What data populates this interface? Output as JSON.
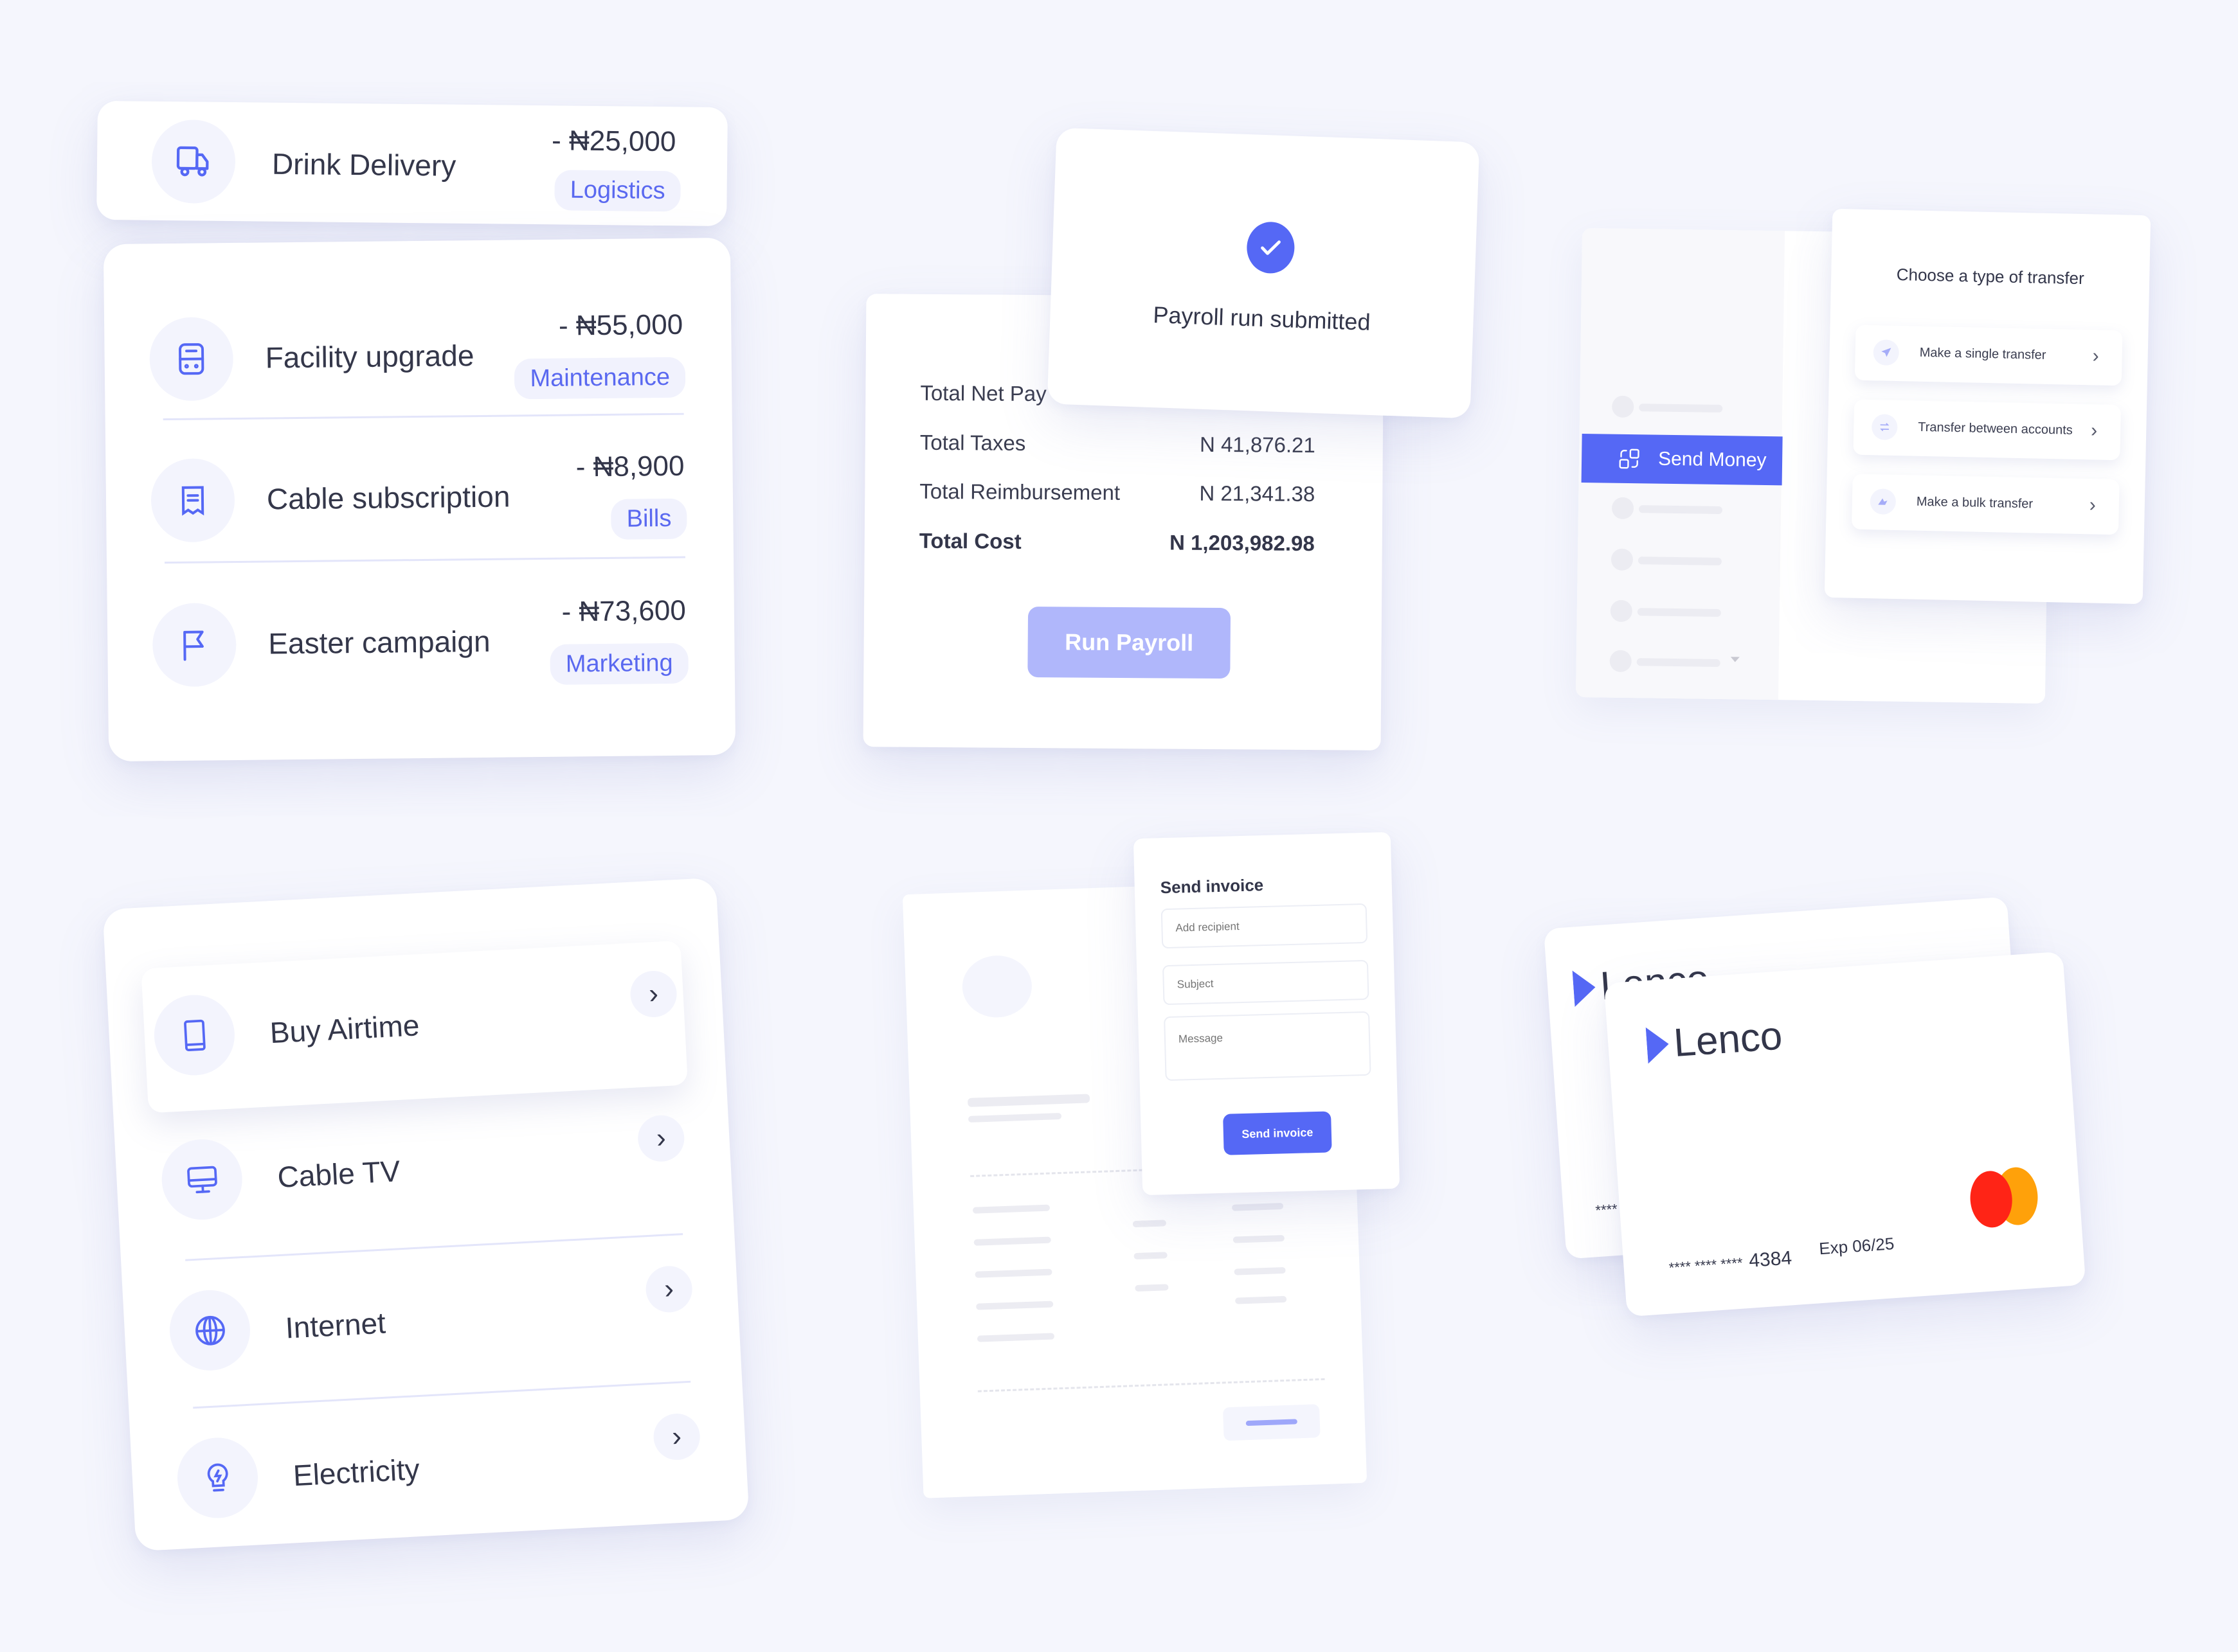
{
  "colors": {
    "accent": "#5568f5",
    "accent_light": "#b0b7fb",
    "background": "#f5f6fd",
    "mastercard_red": "#ff2416",
    "mastercard_orange": "#ffa10a"
  },
  "expenses": {
    "featured": {
      "icon": "truck-icon",
      "title": "Drink Delivery",
      "amount": "- ₦25,000",
      "category": "Logistics"
    },
    "items": [
      {
        "icon": "server-icon",
        "title": "Facility upgrade",
        "amount": "- ₦55,000",
        "category": "Maintenance"
      },
      {
        "icon": "receipt-icon",
        "title": "Cable subscription",
        "amount": "- ₦8,900",
        "category": "Bills"
      },
      {
        "icon": "flag-icon",
        "title": "Easter campaign",
        "amount": "- ₦73,600",
        "category": "Marketing"
      }
    ]
  },
  "payroll": {
    "confirmation": {
      "icon": "check-circle-icon",
      "message": "Payroll run submitted"
    },
    "rows": [
      {
        "label": "Total Net Pay",
        "value": ""
      },
      {
        "label": "Total  Taxes",
        "value": "N 41,876.21"
      },
      {
        "label": "Total  Reimbursement",
        "value": "N 21,341.38"
      },
      {
        "label": "Total Cost",
        "value": "N 1,203,982.98"
      }
    ],
    "run_button": "Run Payroll"
  },
  "transfer": {
    "sidebar_active": {
      "icon": "send-money-icon",
      "label": "Send Money"
    },
    "title": "Choose a type of transfer",
    "options": [
      {
        "icon": "paper-plane-icon",
        "label": "Make a single transfer"
      },
      {
        "icon": "swap-arrows-icon",
        "label": "Transfer between accounts"
      },
      {
        "icon": "bulk-send-icon",
        "label": "Make a bulk transfer"
      }
    ]
  },
  "bills": {
    "items": [
      {
        "icon": "phone-icon",
        "label": "Buy Airtime"
      },
      {
        "icon": "monitor-icon",
        "label": "Cable TV"
      },
      {
        "icon": "globe-icon",
        "label": "Internet"
      },
      {
        "icon": "lightbulb-icon",
        "label": "Electricity"
      }
    ]
  },
  "invoice": {
    "title": "Send invoice",
    "recipient_placeholder": "Add recipient",
    "subject_placeholder": "Subject",
    "message_placeholder": "Message",
    "send_button": "Send invoice"
  },
  "cards": {
    "brand": "Lenco",
    "back_card_number": "****",
    "front_card_number_mask": "**** **** ****",
    "front_card_last4": "4384",
    "expiry": "Exp 06/25",
    "network": "mastercard"
  }
}
